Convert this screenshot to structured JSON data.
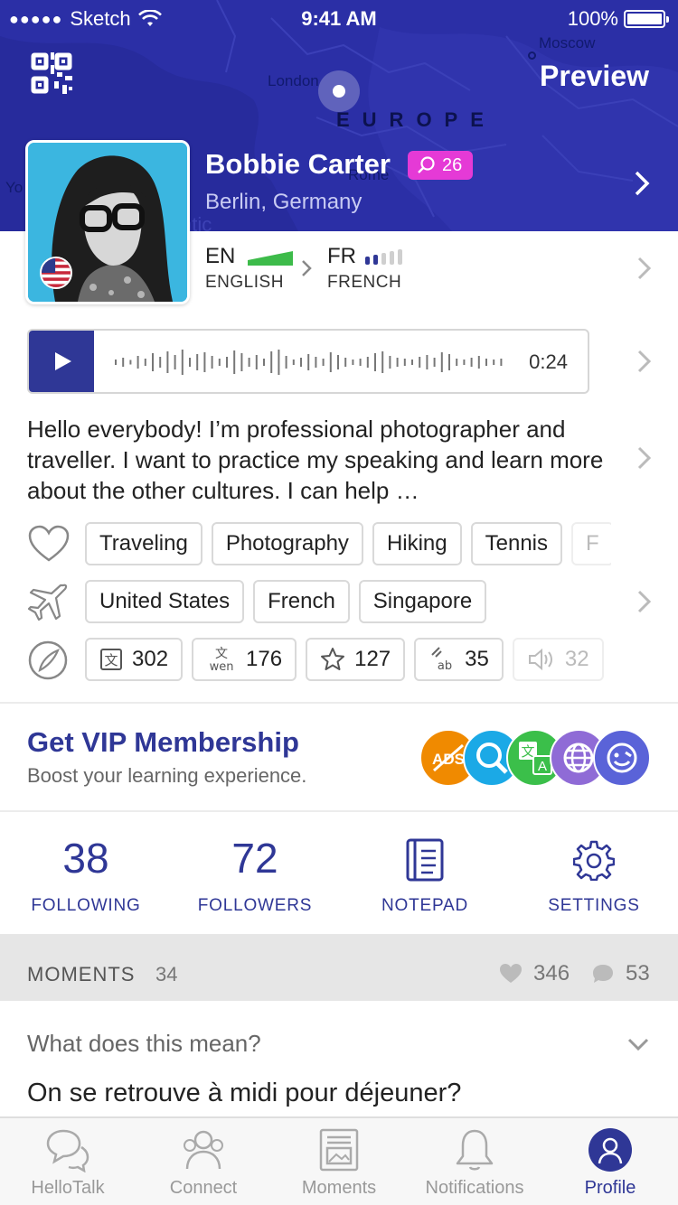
{
  "status_bar": {
    "carrier": "Sketch",
    "time": "9:41 AM",
    "battery": "100%"
  },
  "header": {
    "preview_label": "Preview",
    "map_labels": {
      "london": "London",
      "moscow": "Moscow",
      "rome": "Rome",
      "europe": "EUROPE",
      "yo": "Yo",
      "ntic": "ntic"
    }
  },
  "profile": {
    "name": "Bobbie Carter",
    "badge_count": "26",
    "location": "Berlin, Germany",
    "native": {
      "code": "EN",
      "name": "ENGLISH",
      "level": 5
    },
    "learning": {
      "code": "FR",
      "name": "FRENCH",
      "level": 2
    },
    "voice_duration": "0:24",
    "bio": "Hello everybody! I’m professional photographer and traveller. I want to practice my speaking and learn more about the other cultures. I can help …",
    "interests": [
      "Traveling",
      "Photography",
      "Hiking",
      "Tennis",
      "F"
    ],
    "places": [
      "United States",
      "French",
      "Singapore"
    ],
    "stats_chips": [
      {
        "icon": "translate-icon",
        "value": "302"
      },
      {
        "icon": "transliterate-icon",
        "value": "176"
      },
      {
        "icon": "star-icon",
        "value": "127"
      },
      {
        "icon": "correction-icon",
        "value": "35"
      },
      {
        "icon": "speaker-icon",
        "value": "32"
      }
    ]
  },
  "vip": {
    "title": "Get VIP Membership",
    "subtitle": "Boost your learning experience.",
    "icon_colors": [
      "#f08a00",
      "#1ba9e6",
      "#3bbf4a",
      "#8f6bd6",
      "#5a63d8"
    ]
  },
  "counters": {
    "following": {
      "value": "38",
      "label": "FOLLOWING"
    },
    "followers": {
      "value": "72",
      "label": "FOLLOWERS"
    },
    "notepad": {
      "label": "NOTEPAD"
    },
    "settings": {
      "label": "SETTINGS"
    }
  },
  "moments": {
    "label": "MOMENTS",
    "count": "34",
    "likes": "346",
    "comments": "53",
    "question": "What does this mean?",
    "text": "On se retrouve à midi pour déjeuner?"
  },
  "tabs": [
    {
      "label": "HelloTalk"
    },
    {
      "label": "Connect"
    },
    {
      "label": "Moments"
    },
    {
      "label": "Notifications"
    },
    {
      "label": "Profile"
    }
  ],
  "colors": {
    "accent": "#2f3796",
    "hero": "#2b2fa6",
    "badge": "#e53ad6",
    "level_green": "#3dbb4a"
  }
}
